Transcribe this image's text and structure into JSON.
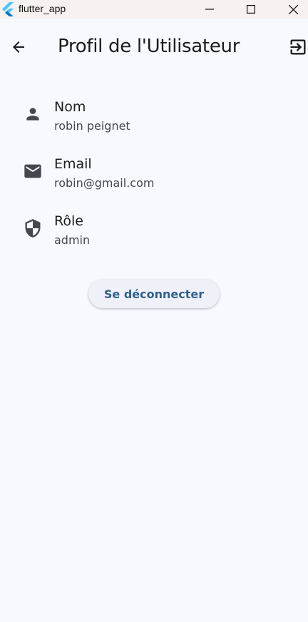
{
  "window": {
    "title": "flutter_app",
    "controls": {
      "minimize_icon": "minimize-icon",
      "maximize_icon": "maximize-icon",
      "close_icon": "close-icon"
    }
  },
  "appbar": {
    "title": "Profil de l'Utilisateur",
    "back_icon": "arrow-back-icon",
    "action_icon": "logout-icon"
  },
  "profile": {
    "fields": [
      {
        "icon": "person-icon",
        "label": "Nom",
        "value": "robin peignet"
      },
      {
        "icon": "mail-icon",
        "label": "Email",
        "value": "robin@gmail.com"
      },
      {
        "icon": "shield-icon",
        "label": "Rôle",
        "value": "admin"
      }
    ]
  },
  "actions": {
    "logout_label": "Se déconnecter"
  },
  "colors": {
    "background": "#f8f9ff",
    "titlebar": "#f7f1ef",
    "button_text": "#2f5f8f",
    "flutter_blue_light": "#47c5fb",
    "flutter_blue_dark": "#0175c2"
  }
}
